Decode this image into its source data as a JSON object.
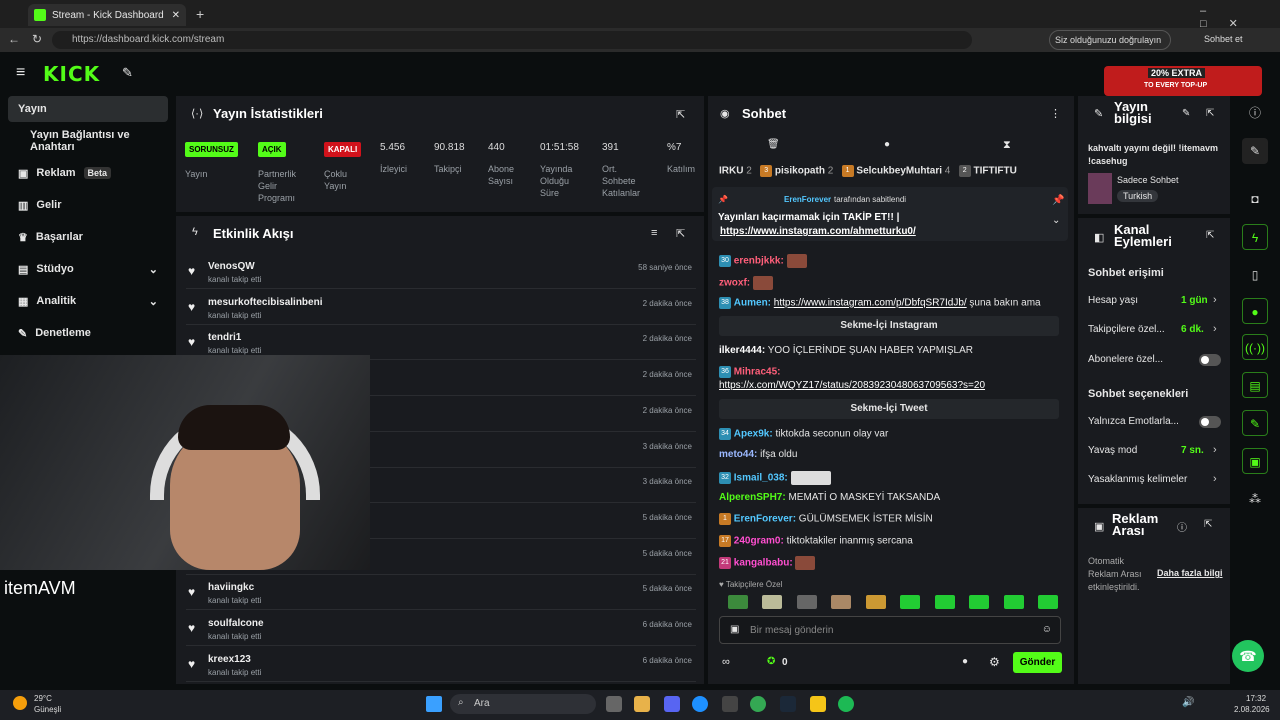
{
  "browser": {
    "tab_title": "Stream - Kick Dashboard",
    "url": "https://dashboard.kick.com/stream",
    "verify_label": "Siz olduğunuzu doğrulayın",
    "sohbet_label": "Sohbet et"
  },
  "brand": {
    "logo": "KICK",
    "beta": "BETA"
  },
  "ad": {
    "line1": "20% EXTRA",
    "line2": "TO EVERY TOP-UP"
  },
  "nav": {
    "items": [
      {
        "label": "Yayın"
      },
      {
        "label": "Yayın Bağlantısı ve Anahtarı"
      },
      {
        "label": "Reklam",
        "badge": "Beta"
      },
      {
        "label": "Gelir"
      },
      {
        "label": "Başarılar"
      },
      {
        "label": "Stüdyo"
      },
      {
        "label": "Analitik"
      },
      {
        "label": "Denetleme"
      }
    ]
  },
  "stats": {
    "title": "Yayın İstatistikleri",
    "status_badges": [
      "SORUNSUZ",
      "AÇIK",
      "KAPALI"
    ],
    "status_labels": [
      "Yayın",
      "Partnerlik Gelir Programı",
      "Çoklu Yayın"
    ],
    "values": [
      "5.456",
      "90.818",
      "440",
      "01:51:58",
      "391",
      "%7"
    ],
    "labels": [
      "İzleyici",
      "Takipçi",
      "Abone Sayısı",
      "Yayında Olduğu Süre",
      "Ort. Sohbete Katılanlar",
      "Katılım"
    ]
  },
  "activity": {
    "title": "Etkinlik Akışı",
    "sub": "kanalı takip etti",
    "rows": [
      {
        "name": "VenosQW",
        "time": "58 saniye önce"
      },
      {
        "name": "mesurkoftecibisalinbeni",
        "time": "2 dakika önce"
      },
      {
        "name": "tendri1",
        "time": "2 dakika önce"
      },
      {
        "name": "",
        "time": "2 dakika önce"
      },
      {
        "name": "",
        "time": "2 dakika önce"
      },
      {
        "name": "",
        "time": "3 dakika önce"
      },
      {
        "name": "",
        "time": "3 dakika önce"
      },
      {
        "name": "",
        "time": "5 dakika önce"
      },
      {
        "name": "",
        "time": "5 dakika önce"
      },
      {
        "name": "haviingkc",
        "time": "5 dakika önce"
      },
      {
        "name": "soulfalcone",
        "time": "6 dakika önce"
      },
      {
        "name": "kreex123",
        "time": "6 dakika önce"
      }
    ]
  },
  "overlay": {
    "brand": "itemAVM"
  },
  "chat": {
    "title": "Sohbet",
    "top": [
      {
        "name": "IRKU",
        "n": "2"
      },
      {
        "name": "pisikopath",
        "n": "2"
      },
      {
        "name": "SelcukbeyMuhtari",
        "n": "4"
      },
      {
        "name": "TIFTIFTU",
        "n": ""
      }
    ],
    "pinned": {
      "by": "ErenForever",
      "suffix": "tarafından sabitlendi",
      "text": "Yayınları kaçırmamak için TAKİP ET!! |",
      "link": "https://www.instagram.com/ahmetturku0/"
    },
    "messages": [
      {
        "user": "erenbjkkk:",
        "color": "#ff5f7a"
      },
      {
        "user": "zwoxf:",
        "color": "#ff5f7a"
      },
      {
        "user": "Aumen:",
        "color": "#53c8ff",
        "link": "https://www.instagram.com/p/DbfqSR7IdJb/",
        "text": " şuna bakın ama"
      },
      {
        "user": "ilker4444:",
        "color": "#ffffff",
        "text": " YOO İÇLERİNDE ŞUAN HABER YAPMIŞLAR"
      },
      {
        "user": "Mihrac45:",
        "color": "#ff5f7a",
        "link": "https://x.com/WQYZ17/status/2083923048063709563?s=20"
      },
      {
        "user": "Apex9k:",
        "color": "#53c8ff",
        "text": " tiktokda seconun olay var"
      },
      {
        "user": "meto44:",
        "color": "#9bb8ff",
        "text": " ifşa oldu"
      },
      {
        "user": "Ismail_038:",
        "color": "#53c8ff"
      },
      {
        "user": "AlperenSPH7:",
        "color": "#53fc18",
        "text": " MEMATİ O MASKEYİ TAKSANDA"
      },
      {
        "user": "ErenForever:",
        "color": "#53c8ff",
        "text": " GÜLÜMSEMEK İSTER MİSİN"
      },
      {
        "user": "240gram0:",
        "color": "#ff4fd0",
        "text": " tiktoktakiler inanmış sercana"
      },
      {
        "user": "kangalbabu:",
        "color": "#ff4fd0"
      }
    ],
    "embed_instagram": "Sekme-İçi Instagram",
    "embed_tweet": "Sekme-İçi Tweet",
    "followers_only": "Takipçilere Özel",
    "placeholder": "Bir mesaj gönderin",
    "send": "Gönder",
    "count": "0"
  },
  "info": {
    "title": "Yayın bilgisi",
    "stream_title": "kahvaltı yayını değil! !itemavm !casehug",
    "category": "Sadece Sohbet",
    "tag": "Turkish"
  },
  "channel": {
    "title": "Kanal Eylemleri",
    "access": "Sohbet erişimi",
    "account_age": "Hesap yaşı",
    "account_age_val": "1 gün",
    "followers": "Takipçilere özel...",
    "followers_val": "6 dk.",
    "subs": "Abonelere özel...",
    "options": "Sohbet seçenekleri",
    "emotes": "Yalnızca Emotlarla...",
    "slow": "Yavaş mod",
    "slow_val": "7 sn.",
    "banned": "Yasaklanmış kelimeler"
  },
  "adbreak": {
    "title": "Reklam Arası",
    "text": "Otomatik Reklam Arası etkinleştirildi.",
    "link": "Daha fazla bilgi"
  },
  "taskbar": {
    "temp": "29°C",
    "weather": "Güneşli",
    "search": "Ara",
    "time": "17:32",
    "date": "2.08.2026"
  },
  "colors": {
    "accent": "#53fc18",
    "panel": "#191b1f",
    "bg": "#0b0e0f"
  }
}
